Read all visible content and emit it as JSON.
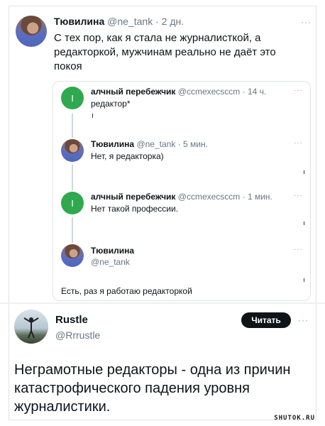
{
  "tweet1": {
    "author_name": "Тювилина",
    "author_handle": "@ne_tank",
    "time": "· 2 дн.",
    "more": "···",
    "text_lines": [
      "С тех пор, как я стала не журналисткой, а",
      "редакторкой, мужчинам реально не даёт это",
      "покоя"
    ]
  },
  "thread": {
    "items": [
      {
        "name": "алчный перебежчик",
        "meta": "@ccmexecsccm · 14 ч.",
        "text": "редактор*",
        "more": "···",
        "avatar_letter": "I"
      },
      {
        "name": "Тювилина",
        "meta": "@ne_tank · 5 мин.",
        "text": "Нет, я редакторка)",
        "more": "···"
      },
      {
        "name": "алчный перебежчик",
        "meta": "@ccmexecsccm · 1 мин.",
        "text": "Нет такой профессии.",
        "more": "···",
        "avatar_letter": "I"
      },
      {
        "name": "Тювилина",
        "meta": "@ne_tank",
        "more": "···"
      }
    ],
    "reply_text": "Есть, раз я работаю редакторкой"
  },
  "tweet2": {
    "author_name": "Rustle",
    "author_handle": "@Rrrustle",
    "follow_label": "Читать",
    "more": "···",
    "text_lines": [
      "Неграмотные редакторы - одна из причин",
      "катастрофического падения уровня",
      "журналистики."
    ]
  },
  "watermark": "SHUTOK.RU"
}
